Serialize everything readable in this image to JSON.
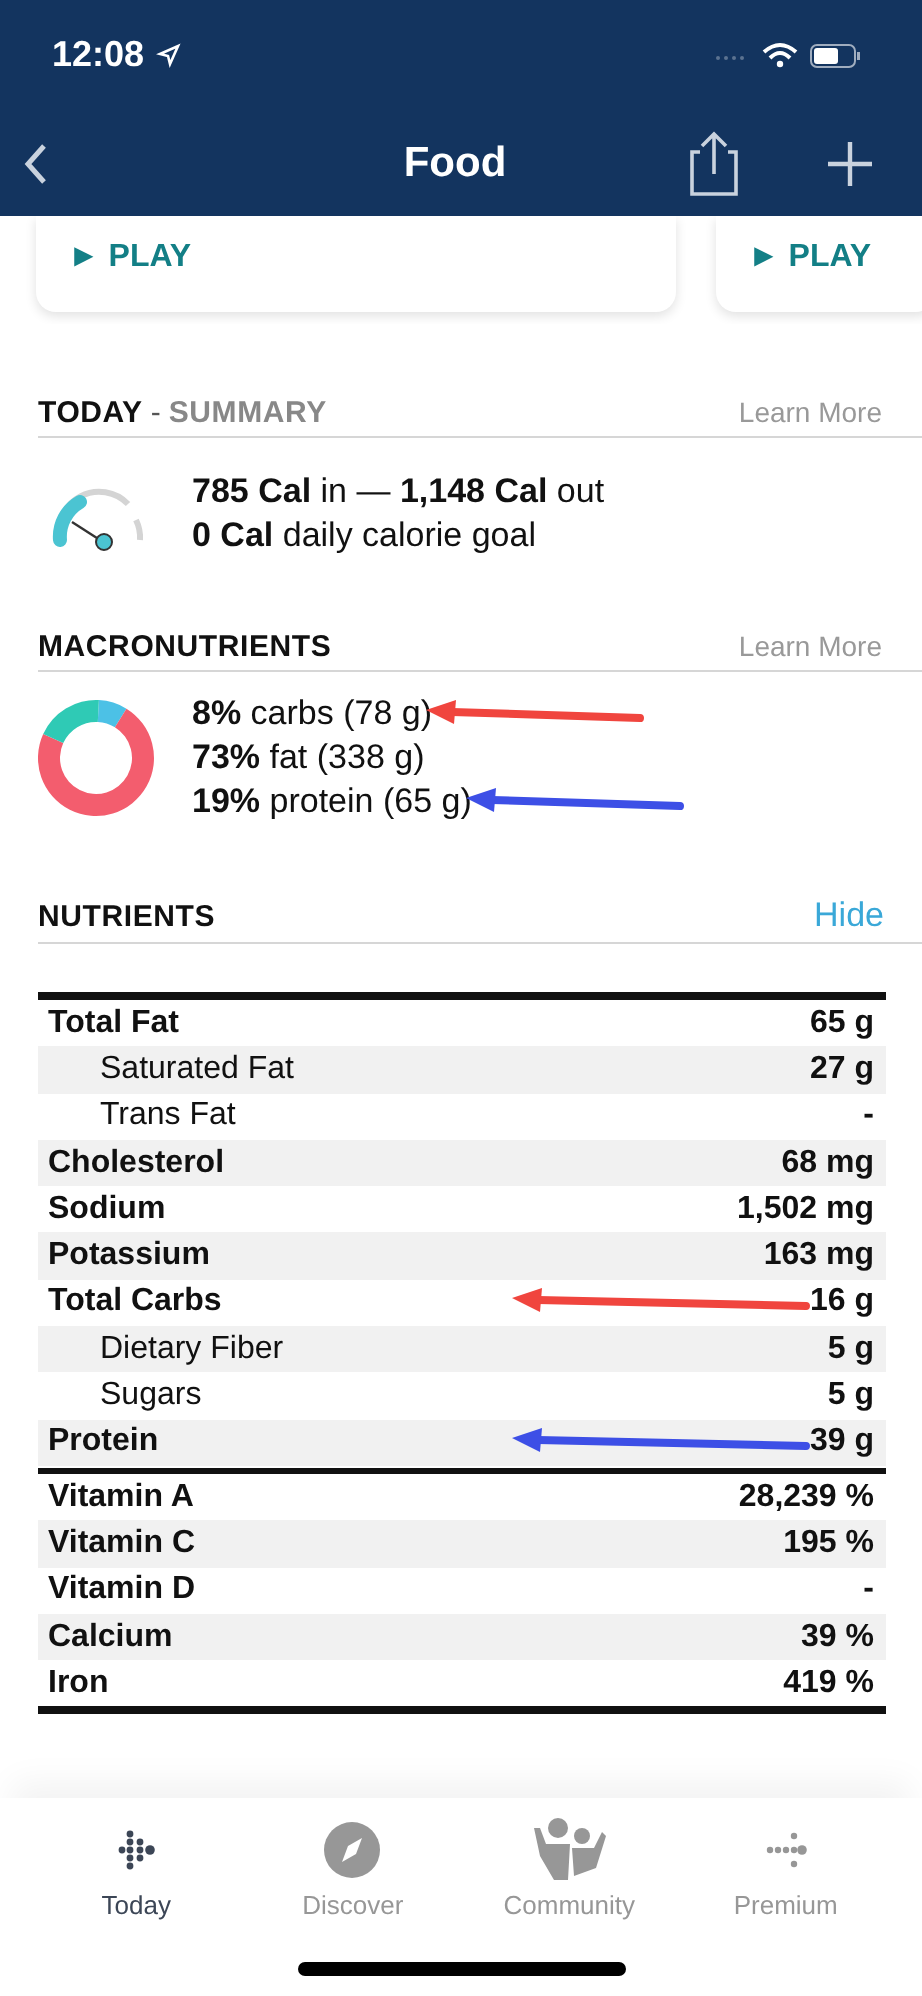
{
  "status_bar": {
    "time": "12:08"
  },
  "nav": {
    "title": "Food"
  },
  "cards": [
    {
      "play": "► PLAY"
    },
    {
      "play": "► PLAY"
    }
  ],
  "summary": {
    "title": "TODAY",
    "subtitle": "SUMMARY",
    "separator": "-",
    "link": "Learn More",
    "lines": [
      "**785 Cal** in — **1,148 Cal** out",
      "**0 Cal** daily calorie goal"
    ]
  },
  "macros": {
    "title": "MACRONUTRIENTS",
    "link": "Learn More",
    "lines": [
      {
        "text": "**8%** carbs (78 g)",
        "annotation": {
          "kind": "arrow",
          "color": "#f0453e"
        }
      },
      {
        "text": "**73%** fat (338 g)"
      },
      {
        "text": "**19%** protein (65 g)",
        "annotation": {
          "kind": "arrow",
          "color": "#3d4fe6"
        }
      }
    ]
  },
  "nutrients": {
    "title": "NUTRIENTS",
    "toggle": "Hide",
    "groups": [
      [
        {
          "name": "Total Fat",
          "value": "65 g",
          "children": [
            {
              "name": "Saturated Fat",
              "value": "27 g"
            },
            {
              "name": "Trans Fat",
              "value": "-"
            }
          ]
        },
        {
          "name": "Cholesterol",
          "value": "68 mg"
        },
        {
          "name": "Sodium",
          "value": "1,502 mg"
        },
        {
          "name": "Potassium",
          "value": "163 mg"
        },
        {
          "name": "Total Carbs",
          "value": "16 g",
          "annotation": {
            "kind": "arrow",
            "color": "#f0453e"
          },
          "children": [
            {
              "name": "Dietary Fiber",
              "value": "5 g"
            },
            {
              "name": "Sugars",
              "value": "5 g"
            }
          ]
        },
        {
          "name": "Protein",
          "value": "39 g",
          "annotation": {
            "kind": "arrow",
            "color": "#3d4fe6"
          }
        }
      ],
      [
        {
          "name": "Vitamin A",
          "value": "28,239 %"
        },
        {
          "name": "Vitamin C",
          "value": "195 %"
        },
        {
          "name": "Vitamin D",
          "value": "-"
        },
        {
          "name": "Calcium",
          "value": "39 %"
        },
        {
          "name": "Iron",
          "value": "419 %"
        }
      ]
    ]
  },
  "tab_bar": [
    {
      "label": "Today",
      "kind": "dots",
      "selected": true
    },
    {
      "label": "Discover",
      "kind": "compass",
      "selected": false
    },
    {
      "label": "Community",
      "kind": "people",
      "selected": false
    },
    {
      "label": "Premium",
      "kind": "arrow-dots",
      "selected": false
    }
  ]
}
